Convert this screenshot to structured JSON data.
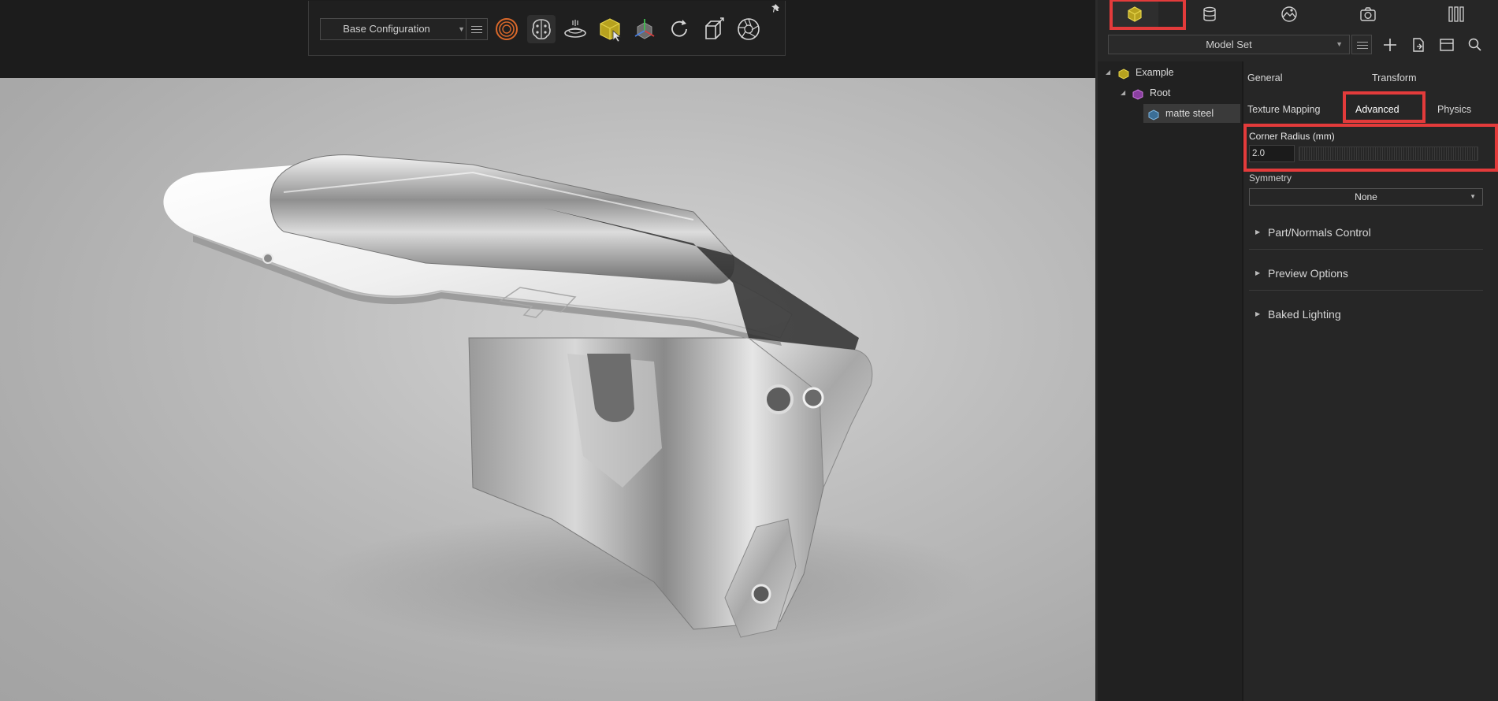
{
  "toolbar": {
    "configuration": "Base Configuration",
    "tools": [
      "render-target-icon",
      "brain-icon",
      "turntable-icon",
      "cube-select-icon",
      "axis-gizmo-icon",
      "refresh-icon",
      "cube-resize-icon",
      "aperture-icon"
    ]
  },
  "right_panel": {
    "tabs": [
      "model-tab-icon",
      "material-tab-icon",
      "environment-tab-icon",
      "camera-tab-icon",
      "library-tab-icon"
    ],
    "active_tab": "model-tab-icon",
    "model_set": "Model Set",
    "tree": [
      {
        "label": "Example",
        "level": 0
      },
      {
        "label": "Root",
        "level": 1
      },
      {
        "label": "matte steel",
        "level": 2,
        "selected": true
      }
    ],
    "prop_tabs": {
      "general": "General",
      "transform": "Transform",
      "texture_mapping": "Texture Mapping",
      "advanced": "Advanced",
      "physics": "Physics"
    },
    "active_prop_tab": "Advanced",
    "corner_radius": {
      "label": "Corner Radius (mm)",
      "value": "2.0"
    },
    "symmetry": {
      "label": "Symmetry",
      "value": "None"
    },
    "sections": [
      "Part/Normals Control",
      "Preview Options",
      "Baked Lighting"
    ]
  },
  "colors": {
    "highlight": "#e33b3b",
    "accent_yellow": "#d9c23a",
    "accent_purple": "#c05bd6",
    "accent_blue": "#4a90c9"
  }
}
